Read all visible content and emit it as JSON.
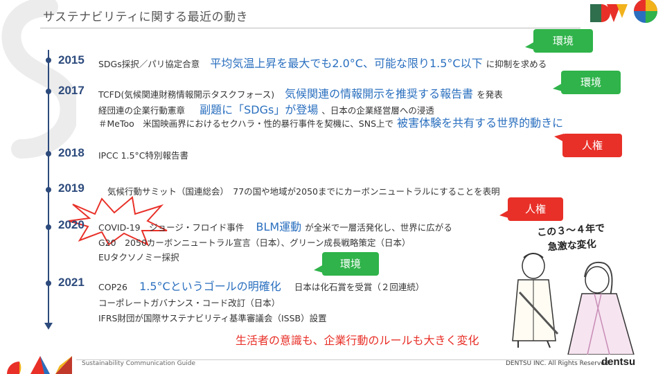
{
  "page": {
    "title": "サステナビリティに関する最近の動き"
  },
  "colors": {
    "navy": "#2c4a7c",
    "blue": "#2a6fbf",
    "green": "#2fb34a",
    "red": "#e83028"
  },
  "timeline": [
    {
      "year": "2015",
      "lines": [
        {
          "t1": "SDGs採択／パリ協定合意",
          "hl": "平均気温上昇を最大でも2.0°C、可能な限り1.5°C以下",
          "t2": "に抑制を求める"
        }
      ]
    },
    {
      "year": "2017",
      "lines": [
        {
          "t1": "TCFD(気候関連財務情報開示タスクフォース)",
          "hl": "気候関連の情報開示を推奨する報告書",
          "t2": "を発表"
        },
        {
          "t1": "経団連の企業行動憲章",
          "hl": "副題に「SDGs」が登場",
          "t2": "、日本の企業経営層への浸透"
        },
        {
          "t1": "＃MeToo　米国映画界におけるセクハラ・性的暴行事件を契機に、SNS上で",
          "hl": "被害体験を共有する世界的動きに",
          "t2": ""
        }
      ]
    },
    {
      "year": "2018",
      "lines": [
        {
          "t1": "IPCC 1.5°C特別報告書"
        }
      ]
    },
    {
      "year": "2019",
      "lines": [
        {
          "t1": "気候行動サミット（国連総会）　77の国や地域が2050までにカーボンニュートラルにすることを表明"
        }
      ]
    },
    {
      "year": "2020",
      "lines": [
        {
          "t1": "COVID-19　ジョージ・フロイド事件",
          "hl": "BLM運動",
          "t2": "が全米で一層活発化し、世界に広がる"
        },
        {
          "t1": "G20　2050カーボンニュートラル宣言（日本）、グリーン成長戦略策定（日本）"
        },
        {
          "t1": "EUタクソノミー採択"
        }
      ]
    },
    {
      "year": "2021",
      "lines": [
        {
          "t1": "COP26",
          "hl": "1.5°Cというゴールの明確化",
          "t2": "日本は化石賞を受賞（２回連続）"
        },
        {
          "t1": "コーポレートガバナンス・コード改訂（日本）"
        },
        {
          "t1": "IFRS財団が国際サステナビリティ基準審議会（ISSB）設置"
        }
      ]
    }
  ],
  "tags": {
    "env1": "環境",
    "env2": "環境",
    "hr1": "人権",
    "hr2": "人権",
    "env3": "環境"
  },
  "summary": "生活者の意識も、企業行動のルールも大きく変化",
  "illustration": {
    "caption_line1": "この３～４年で",
    "caption_line2": "急激な変化"
  },
  "footer": {
    "guide": "Sustainability Communication Guide",
    "copyright": "DENTSU INC. All Rights Reserved.",
    "brand": "dentsu"
  }
}
